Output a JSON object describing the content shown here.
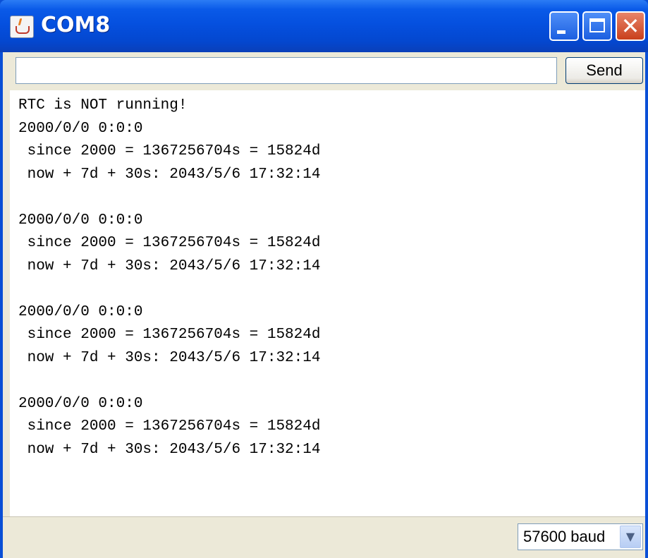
{
  "window": {
    "title": "COM8"
  },
  "toolbar": {
    "input_value": "",
    "send_label": "Send"
  },
  "output": {
    "lines": [
      "RTC is NOT running!",
      "2000/0/0 0:0:0",
      " since 2000 = 1367256704s = 15824d",
      " now + 7d + 30s: 2043/5/6 17:32:14",
      "",
      "2000/0/0 0:0:0",
      " since 2000 = 1367256704s = 15824d",
      " now + 7d + 30s: 2043/5/6 17:32:14",
      "",
      "2000/0/0 0:0:0",
      " since 2000 = 1367256704s = 15824d",
      " now + 7d + 30s: 2043/5/6 17:32:14",
      "",
      "2000/0/0 0:0:0",
      " since 2000 = 1367256704s = 15824d",
      " now + 7d + 30s: 2043/5/6 17:32:14"
    ]
  },
  "footer": {
    "baud_selected": "57600 baud"
  },
  "icons": {
    "app": "java-app-icon",
    "minimize": "minimize-icon",
    "maximize": "maximize-icon",
    "close": "close-icon",
    "dropdown": "chevron-down-icon"
  },
  "colors": {
    "titlebar": "#0550df",
    "close_button": "#c9401c",
    "client_bg": "#ece9d8"
  }
}
